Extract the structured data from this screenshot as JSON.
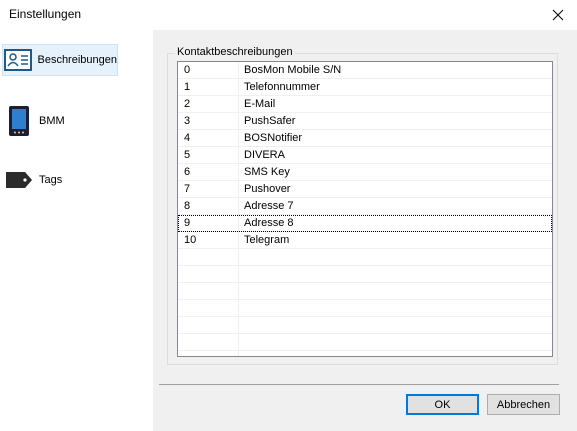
{
  "window": {
    "title": "Einstellungen"
  },
  "sidebar": {
    "items": [
      {
        "label": "Beschreibungen",
        "icon": "contact-card-icon",
        "selected": true
      },
      {
        "label": "BMM",
        "icon": "pager-device-icon",
        "selected": false
      },
      {
        "label": "Tags",
        "icon": "tag-icon",
        "selected": false
      }
    ]
  },
  "group": {
    "label": "Kontaktbeschreibungen"
  },
  "list": {
    "rows": [
      {
        "id": "0",
        "name": "BosMon Mobile S/N"
      },
      {
        "id": "1",
        "name": "Telefonnummer"
      },
      {
        "id": "2",
        "name": "E-Mail"
      },
      {
        "id": "3",
        "name": "PushSafer"
      },
      {
        "id": "4",
        "name": "BOSNotifier"
      },
      {
        "id": "5",
        "name": "DIVERA"
      },
      {
        "id": "6",
        "name": "SMS Key"
      },
      {
        "id": "7",
        "name": "Pushover"
      },
      {
        "id": "8",
        "name": "Adresse 7"
      },
      {
        "id": "9",
        "name": "Adresse 8"
      },
      {
        "id": "10",
        "name": "Telegram"
      }
    ],
    "focused_row": "9"
  },
  "buttons": {
    "ok": "OK",
    "cancel": "Abbrechen"
  },
  "colors": {
    "selection_bg": "#e5f1fb",
    "accent": "#0078d7"
  }
}
